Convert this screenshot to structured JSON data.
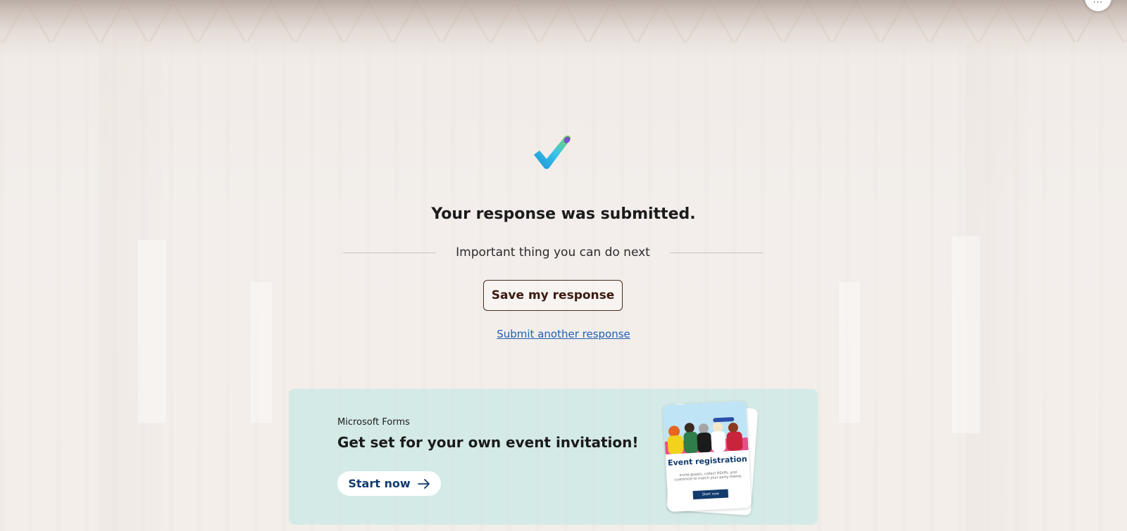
{
  "window": {
    "more_label": "···"
  },
  "confirmation": {
    "icon": "checkmark-icon",
    "title": "Your response was submitted.",
    "next_heading": "Important thing you can do next",
    "save_button": "Save my response",
    "submit_another_link": "Submit another response"
  },
  "promo": {
    "brand": "Microsoft Forms",
    "title": "Get set for your own event invitation!",
    "start_button": "Start now",
    "start_icon": "arrow-right-icon",
    "card": {
      "title": "Event registration",
      "description": "Invite guests, collect RSVPs, and customize to match your party theme.",
      "button": "Start now"
    }
  },
  "colors": {
    "link": "#1f5fb3",
    "save_border": "#4a2c1e",
    "promo_bg": "#cae8e6",
    "start_text": "#123b6e"
  }
}
